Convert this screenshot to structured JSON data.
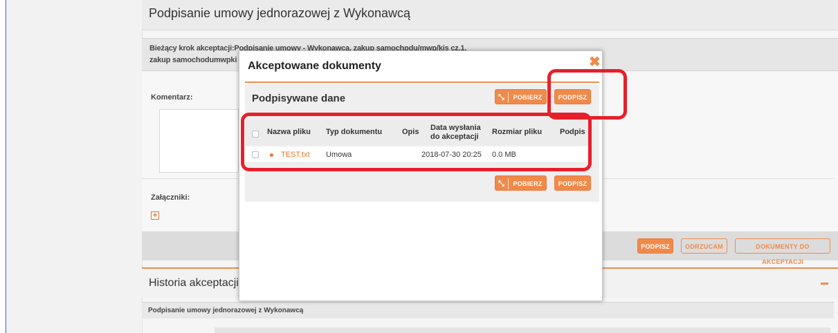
{
  "page": {
    "title": "Podpisanie umowy jednorazowej z Wykonawcą",
    "step_line1": "Bieżący krok akceptacji:Podpisanie umowy - Wykonawca, zakup samochpdu/mwp/kis cz.1,",
    "step_line2": "zakup samochodumwpki",
    "comment_label": "Komentarz:",
    "attachments_label": "Załączniki:",
    "add_attachment_glyph": "+"
  },
  "actions": {
    "sign": "PODPISZ",
    "reject": "ODRZUCAM",
    "docs": "DOKUMENTY DO AKCEPTACJI"
  },
  "history": {
    "title": "Historia akceptacji",
    "subtitle": "Podpisanie umowy jednorazowej z Wykonawcą"
  },
  "modal": {
    "title": "Akceptowane dokumenty",
    "close_glyph": "✖",
    "section_title": "Podpisywane dane",
    "download_label": "POBIERZ",
    "sign_label": "PODPISZ",
    "columns": {
      "name": "Nazwa pliku",
      "type": "Typ dokumentu",
      "desc": "Opis",
      "date_l1": "Data wysłania",
      "date_l2": "do akceptacji",
      "size": "Rozmiar pliku",
      "signature": "Podpis"
    },
    "rows": [
      {
        "name": "TEST.txt",
        "type": "Umowa",
        "desc": "",
        "date": "2018-07-30 20:25",
        "size": "0.0 MB",
        "signature": ""
      }
    ]
  },
  "colors": {
    "accent": "#f08a4b",
    "highlight": "#e6202b",
    "frame": "#3b5bdb"
  }
}
